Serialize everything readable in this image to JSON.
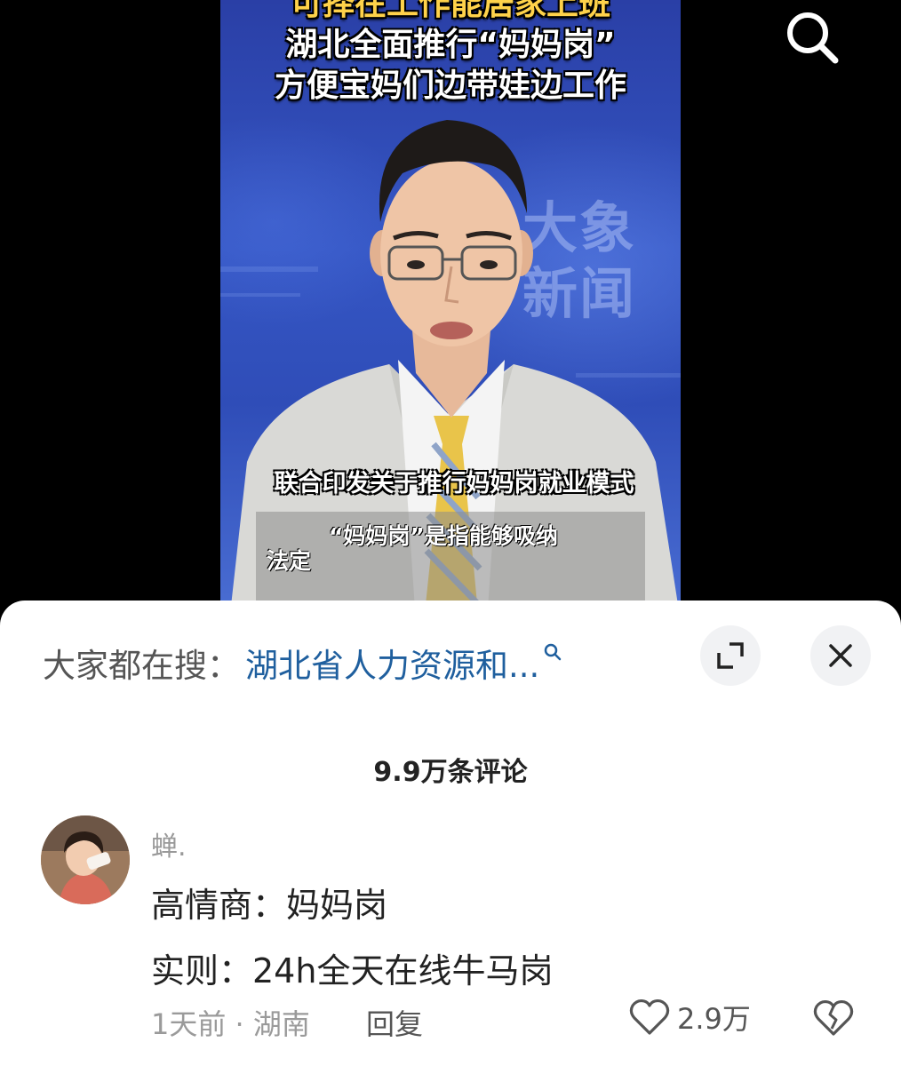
{
  "video": {
    "headline_top": "可择在工作能居家上班",
    "headline_line1": "湖北全面推行“妈妈岗”",
    "headline_line2": "方便宝妈们边带娃边工作",
    "watermark": "大象新闻",
    "subtitle_1": "联合印发关于推行妈妈岗就业模式",
    "subtitle_2": "“妈妈岗”是指能够吸纳",
    "subtitle_3": "法定",
    "search_icon": "search-icon"
  },
  "hot_search": {
    "label": "大家都在搜：",
    "term": "湖北省人力资源和...",
    "icon": "magnifier-icon"
  },
  "buttons": {
    "expand_icon": "expand-icon",
    "close_icon": "close-icon"
  },
  "comments": {
    "count_label": "9.9万条评论",
    "items": [
      {
        "username": "蝉.",
        "line1": "高情商：妈妈岗",
        "line2": "实则：24h全天在线牛马岗",
        "meta": "1天前 · 湖南",
        "reply_label": "回复",
        "likes": "2.9万",
        "like_icon": "heart-icon",
        "dislike_icon": "broken-heart-icon"
      }
    ]
  },
  "colors": {
    "link": "#1f5f9e",
    "video_bg": "#2f4db8",
    "headline_accent": "#ffd24a"
  }
}
